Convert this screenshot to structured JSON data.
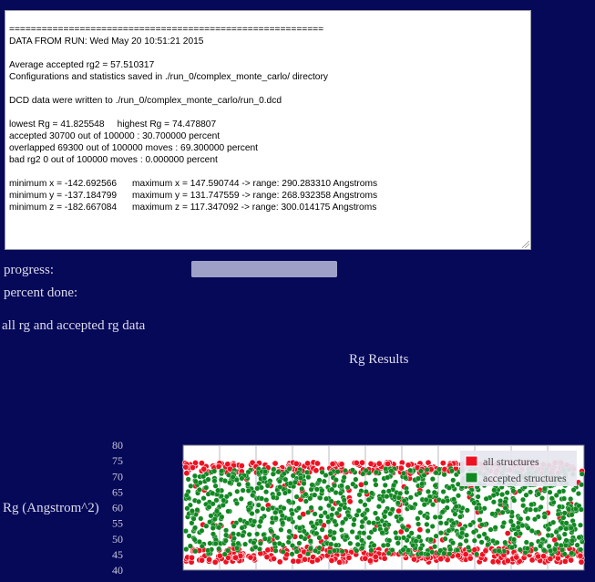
{
  "log": {
    "lines": [
      "==========================================================",
      "DATA FROM RUN: Wed May 20 10:51:21 2015",
      "",
      "Average accepted rg2 = 57.510317",
      "Configurations and statistics saved in ./run_0/complex_monte_carlo/ directory",
      "",
      "DCD data were written to ./run_0/complex_monte_carlo/run_0.dcd",
      "",
      "lowest Rg = 41.825548     highest Rg = 74.478807",
      "accepted 30700 out of 100000 : 30.700000 percent",
      "overlapped 69300 out of 100000 moves : 69.300000 percent",
      "bad rg2 0 out of 100000 moves : 0.000000 percent",
      "",
      "minimum x = -142.692566      maximum x = 147.590744 -> range: 290.283310 Angstroms",
      "minimum y = -137.184799      maximum y = 131.747559 -> range: 268.932358 Angstroms",
      "minimum z = -182.667084      maximum z = 117.347092 -> range: 300.014175 Angstroms",
      "",
      "",
      "",
      "=========================================================="
    ]
  },
  "progress": {
    "label": "progress:",
    "value": 1.0
  },
  "percent_done": {
    "label": "percent done:"
  },
  "section_label": "all rg and accepted rg data",
  "chart_data": {
    "type": "scatter",
    "title": "Rg Results",
    "ylabel": "Rg (Angstrom^2)",
    "xlabel": "",
    "ylim": [
      40,
      80
    ],
    "yticks": [
      40,
      45,
      50,
      55,
      60,
      65,
      70,
      75,
      80
    ],
    "xlim": [
      0,
      100000
    ],
    "grid": true,
    "legend_position": "top-right",
    "series": [
      {
        "name": "all structures",
        "color": "#ee1122",
        "range": [
          41.825548,
          74.478807
        ],
        "count": 100000
      },
      {
        "name": "accepted structures",
        "color": "#118822",
        "count": 30700
      }
    ]
  }
}
